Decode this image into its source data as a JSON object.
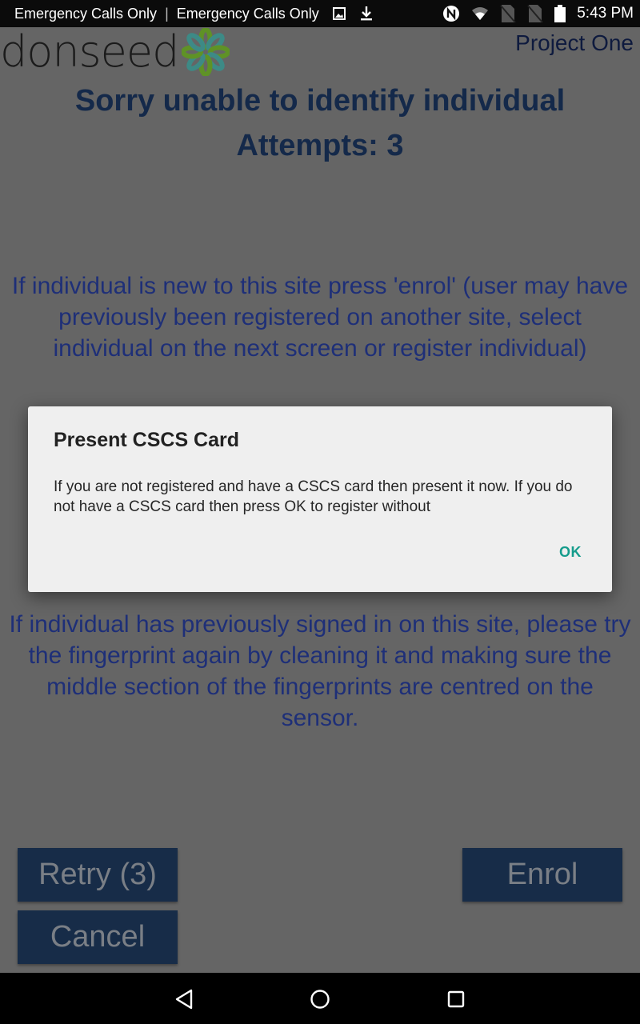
{
  "status_bar": {
    "carrier_1": "Emergency Calls Only",
    "separator": "|",
    "carrier_2": "Emergency Calls Only",
    "left_icons": [
      "image-notification-icon",
      "download-icon"
    ],
    "right_icons": [
      "nfc-icon",
      "wifi-icon",
      "no-sim-icon",
      "no-sim-icon",
      "battery-icon"
    ],
    "time": "5:43 PM"
  },
  "header": {
    "logo_text": "donseed",
    "project_name": "Project One"
  },
  "main": {
    "headline_line1": "Sorry unable to identify individual",
    "headline_line2": "Attempts: 3",
    "enrol_instructions": "If individual is new to this site press 'enrol' (user may have previously been registered on another site, select individual on the next screen or register individual)",
    "retry_instructions": "If individual has previously signed in on this site, please try the fingerprint again by cleaning it and making sure the middle section of the fingerprints are centred on the sensor."
  },
  "buttons": {
    "retry": "Retry (3)",
    "cancel": "Cancel",
    "enrol": "Enrol"
  },
  "dialog": {
    "title": "Present CSCS Card",
    "message": "If you are not registered and have a CSCS card then present it now. If you do not have a CSCS card then press OK to register without",
    "ok_label": "OK"
  },
  "colors": {
    "headline": "#14294a",
    "body_text": "#1e2f78",
    "button_bg": "#172c48",
    "dialog_accent": "#159c8c",
    "logo_green": "#6a9a2a",
    "logo_teal": "#3d8a86"
  },
  "nav_bar": {
    "icons": [
      "back-icon",
      "home-icon",
      "recent-apps-icon"
    ]
  }
}
